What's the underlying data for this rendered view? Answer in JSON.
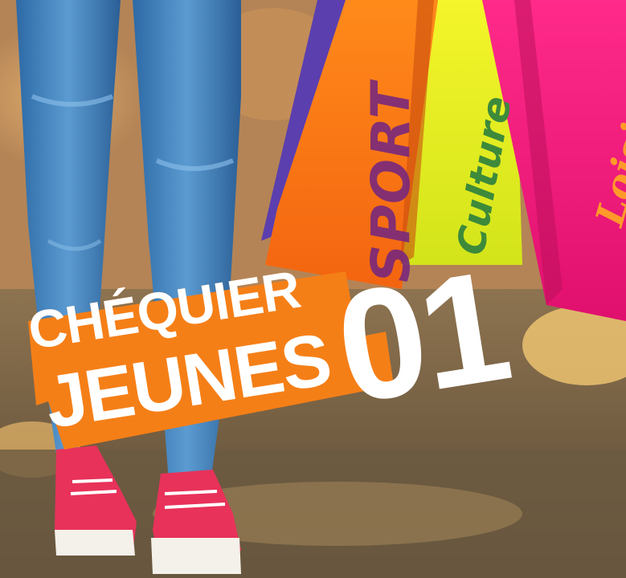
{
  "image": {
    "bags": {
      "sport_label": "SPORT",
      "culture_label": "Culture",
      "loisirs_label": "Loisirs"
    },
    "title": {
      "line1": "CHÉQUIER",
      "line2": "JEUNES",
      "number": "01"
    },
    "colors": {
      "orange": "#f57f17",
      "yellow": "#e6ef1d",
      "pink": "#f0147a",
      "purple": "#6a3fb0",
      "denim": "#3d7fb8",
      "shoe_red": "#e8325a"
    }
  }
}
